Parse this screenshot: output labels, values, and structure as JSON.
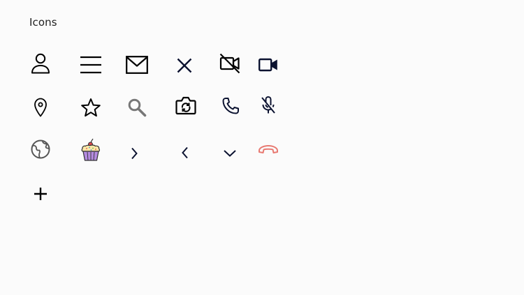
{
  "page": {
    "title": "Icons"
  },
  "icons": [
    {
      "name": "user-icon",
      "color": "#000000"
    },
    {
      "name": "menu-icon",
      "color": "#000000"
    },
    {
      "name": "mail-icon",
      "color": "#000000"
    },
    {
      "name": "close-icon",
      "color": "#0b1230"
    },
    {
      "name": "video-off-icon",
      "color": "#000000"
    },
    {
      "name": "video-icon",
      "color": "#0b1230"
    },
    {
      "name": "location-pin-icon",
      "color": "#000000"
    },
    {
      "name": "star-icon",
      "color": "#000000"
    },
    {
      "name": "search-icon",
      "color": "#777777"
    },
    {
      "name": "switch-camera-icon",
      "color": "#000000"
    },
    {
      "name": "phone-icon",
      "color": "#0b1230"
    },
    {
      "name": "mic-off-icon",
      "color": "#0b1230"
    },
    {
      "name": "globe-icon",
      "color": "#555555"
    },
    {
      "name": "cupcake-icon",
      "color": "#b58be0"
    },
    {
      "name": "chevron-right-icon",
      "color": "#0b1230"
    },
    {
      "name": "chevron-left-icon",
      "color": "#0b1230"
    },
    {
      "name": "chevron-down-icon",
      "color": "#0b1230"
    },
    {
      "name": "hang-up-icon",
      "color": "#e87a72"
    },
    {
      "name": "plus-icon",
      "color": "#000000"
    }
  ]
}
